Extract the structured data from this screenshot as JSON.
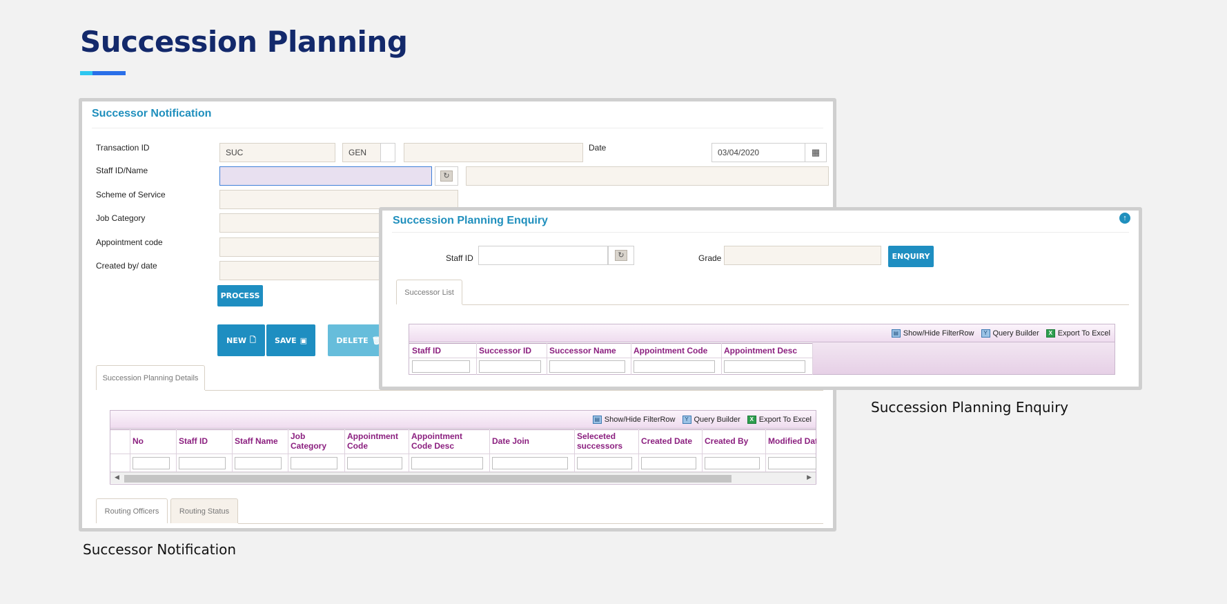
{
  "page": {
    "title": "Succession Planning",
    "accent_colors": [
      "#2ec7f0",
      "#2a6fe8"
    ]
  },
  "captions": {
    "left": "Successor Notification",
    "right": "Succession Planning Enquiry"
  },
  "notification": {
    "title": "Successor Notification",
    "labels": {
      "transaction_id": "Transaction ID",
      "staff_id_name": "Staff ID/Name",
      "scheme": "Scheme of Service",
      "job_category": "Job Category",
      "appointment_code": "Appointment code",
      "created_by": "Created by/ date",
      "date": "Date"
    },
    "values": {
      "transaction_prefix": "SUC",
      "transaction_type": "GEN",
      "transaction_number": "",
      "date": "03/04/2020",
      "staff_id": "",
      "staff_name": ""
    },
    "buttons": {
      "process": "PROCESS",
      "new": "NEW",
      "save": "SAVE",
      "delete": "DELETE"
    },
    "tabs": {
      "details": "Succession Planning Details",
      "routing_officers": "Routing Officers",
      "routing_status": "Routing Status"
    },
    "grid": {
      "toolbar": {
        "filter_row": "Show/Hide FilterRow",
        "query_builder": "Query Builder",
        "export": "Export To Excel"
      },
      "columns": [
        "No",
        "Staff ID",
        "Staff Name",
        "Job Category",
        "Appointment Code",
        "Appointment Code Desc",
        "Date Join",
        "Seleceted successors",
        "Created Date",
        "Created By",
        "Modified Dat"
      ]
    },
    "icons": [
      "calendar-icon",
      "refresh-lookup-icon",
      "new-document-icon",
      "save-disk-icon",
      "delete-trash-icon"
    ]
  },
  "enquiry": {
    "title": "Succession Planning Enquiry",
    "labels": {
      "staff_id": "Staff ID",
      "grade": "Grade"
    },
    "values": {
      "staff_id": "",
      "grade": ""
    },
    "buttons": {
      "enquiry": "ENQUIRY"
    },
    "tabs": {
      "successor_list": "Successor List"
    },
    "grid": {
      "toolbar": {
        "filter_row": "Show/Hide FilterRow",
        "query_builder": "Query Builder",
        "export": "Export To Excel"
      },
      "columns": [
        "Staff ID",
        "Successor ID",
        "Successor Name",
        "Appointment Code",
        "Appointment Desc"
      ]
    },
    "icons": [
      "scroll-up-icon",
      "refresh-lookup-icon"
    ]
  }
}
